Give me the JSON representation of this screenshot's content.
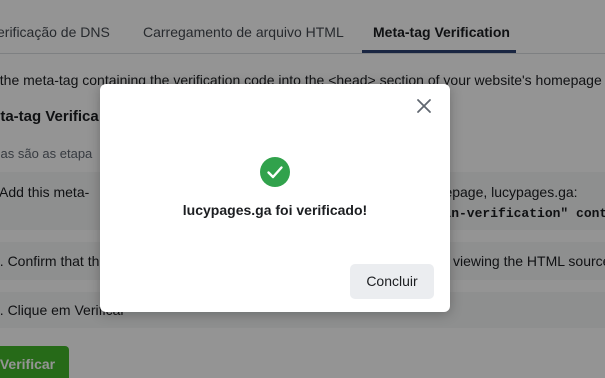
{
  "tabs": [
    {
      "label": "erificação de DNS"
    },
    {
      "label": "Carregamento de arquivo HTML"
    },
    {
      "label": "Meta-tag Verification"
    }
  ],
  "background": {
    "intro": "t the meta-tag containing the verification code into the <head> section of your website's homepage",
    "section_title": "eta-tag Verifica",
    "steps_intro": "sas são as etapa",
    "step1_left": ". Add this meta-",
    "step1_right": "omepage, lucypages.ga:",
    "step1_code": "omain-verification\" conte",
    "step2_left": "2. Confirm that th",
    "step2_right": "viewing the HTML source",
    "step3_left": "3. Clique em Verificar",
    "verify_button": "Verificar"
  },
  "modal": {
    "message": "lucypages.ga foi verificado!",
    "done_button": "Concluir",
    "success_color": "#31a24c",
    "icons": {
      "close": "close-icon",
      "success": "check-circle-icon"
    }
  }
}
